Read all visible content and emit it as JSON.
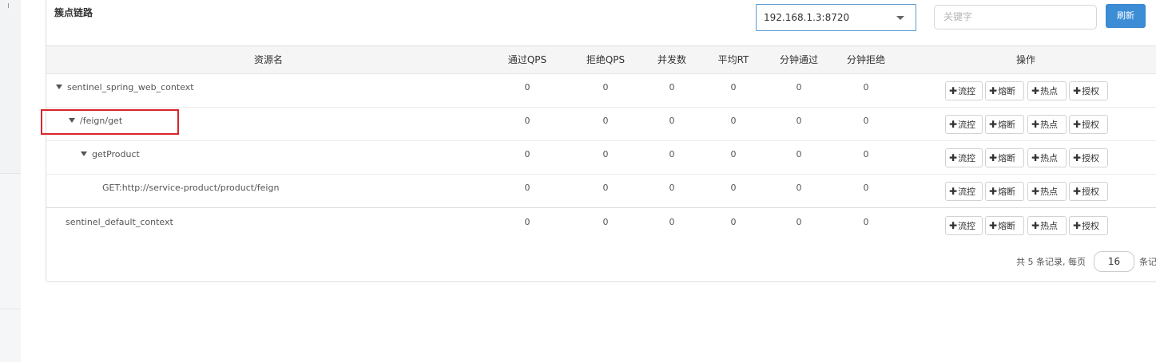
{
  "panel": {
    "title": "簇点链路",
    "machine_select": "192.168.1.3:8720",
    "keyword_placeholder": "关键字",
    "refresh_label": "刷新"
  },
  "table": {
    "headers": {
      "resource": "资源名",
      "pass_qps": "通过QPS",
      "block_qps": "拒绝QPS",
      "concurrency": "并发数",
      "avg_rt": "平均RT",
      "min_pass": "分钟通过",
      "min_block": "分钟拒绝",
      "ops": "操作"
    },
    "rows": [
      {
        "name": "sentinel_spring_web_context",
        "expanded": true,
        "pass_qps": "0",
        "block_qps": "0",
        "concurrency": "0",
        "avg_rt": "0",
        "min_pass": "0",
        "min_block": "0"
      },
      {
        "name": "/feign/get",
        "expanded": true,
        "pass_qps": "0",
        "block_qps": "0",
        "concurrency": "0",
        "avg_rt": "0",
        "min_pass": "0",
        "min_block": "0"
      },
      {
        "name": "getProduct",
        "expanded": true,
        "pass_qps": "0",
        "block_qps": "0",
        "concurrency": "0",
        "avg_rt": "0",
        "min_pass": "0",
        "min_block": "0"
      },
      {
        "name": "GET:http://service-product/product/feign",
        "expanded": false,
        "pass_qps": "0",
        "block_qps": "0",
        "concurrency": "0",
        "avg_rt": "0",
        "min_pass": "0",
        "min_block": "0"
      },
      {
        "name": "sentinel_default_context",
        "expanded": false,
        "pass_qps": "0",
        "block_qps": "0",
        "concurrency": "0",
        "avg_rt": "0",
        "min_pass": "0",
        "min_block": "0"
      }
    ],
    "op_buttons": {
      "flow": "流控",
      "degrade": "熔断",
      "hot": "热点",
      "auth": "授权"
    },
    "op_plus": "✚"
  },
  "pager": {
    "prefix": "共 5 条记录, 每页",
    "page_size": "16",
    "suffix": "条记录"
  },
  "colors": {
    "primary": "#3c8dd6",
    "highlight": "#d9262a"
  }
}
